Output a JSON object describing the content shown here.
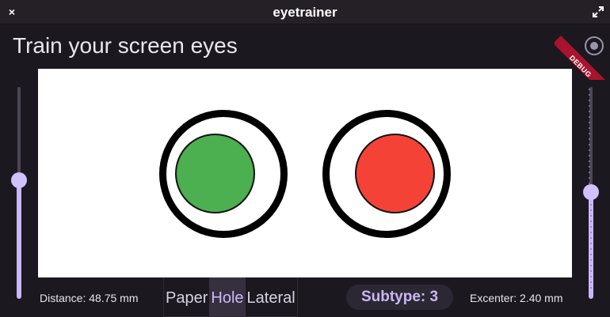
{
  "window": {
    "title": "eyetrainer",
    "close_symbol": "×"
  },
  "header": {
    "title": "Train your screen eyes",
    "debug_banner": "DEBUG"
  },
  "distance_slider": {
    "level": 0.51
  },
  "excenter_slider": {
    "level": 0.45
  },
  "targets": [
    {
      "name": "left-target",
      "fill_color": "#4caf50"
    },
    {
      "name": "right-target",
      "fill_color": "#f44336"
    }
  ],
  "bottom": {
    "distance_label": "Distance: 48.75 mm",
    "excenter_label": "Excenter: 2.40 mm",
    "modes": [
      "Paper",
      "Hole",
      "Lateral"
    ],
    "selected_mode": "Hole",
    "subtype_label": "Subtype: 3"
  },
  "colors": {
    "accent": "#c9b6f6",
    "background": "#1b1820",
    "canvas": "#ffffff"
  }
}
